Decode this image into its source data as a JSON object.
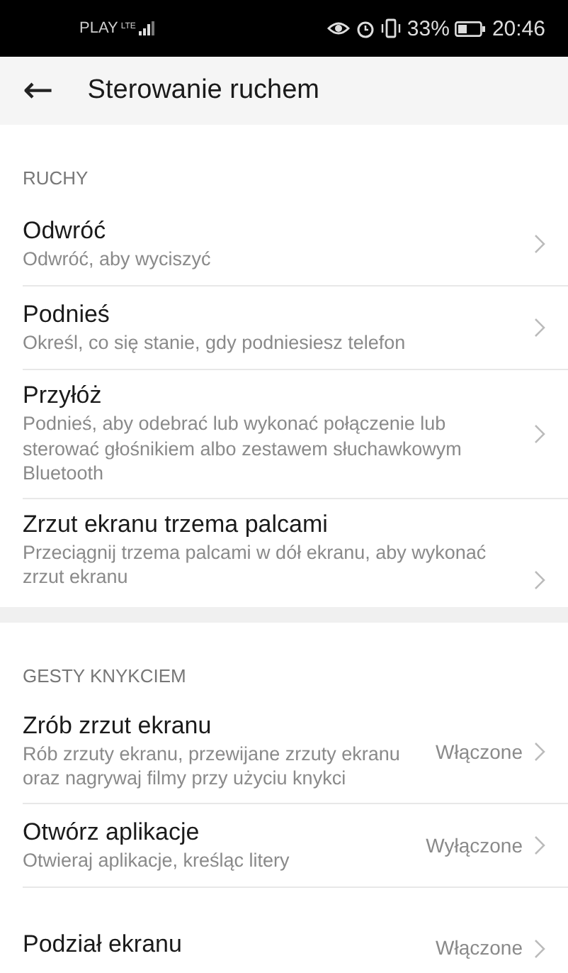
{
  "status_bar": {
    "carrier": "PLAY",
    "network": "LTE",
    "battery_percent": "33%",
    "time": "20:46"
  },
  "header": {
    "back": "←",
    "title": "Sterowanie ruchem"
  },
  "sections": [
    {
      "title": "RUCHY",
      "items": [
        {
          "title": "Odwróć",
          "subtitle": "Odwróć, aby wyciszyć"
        },
        {
          "title": "Podnieś",
          "subtitle": "Określ, co się stanie, gdy podniesiesz telefon"
        },
        {
          "title": "Przyłóż",
          "subtitle": "Podnieś, aby odebrać lub wykonać połączenie lub sterować głośnikiem albo zestawem słuchawkowym Bluetooth"
        },
        {
          "title": "Zrzut ekranu trzema palcami",
          "subtitle": "Przeciągnij trzema palcami w dół ekranu, aby wykonać zrzut ekranu"
        }
      ]
    },
    {
      "title": "GESTY KNYKCIEM",
      "items": [
        {
          "title": "Zrób zrzut ekranu",
          "subtitle": "Rób zrzuty ekranu, przewijane zrzuty ekranu oraz nagrywaj filmy przy użyciu knykci",
          "value": "Włączone"
        },
        {
          "title": "Otwórz aplikacje",
          "subtitle": "Otwieraj aplikacje, kreśląc litery",
          "value": "Wyłączone"
        },
        {
          "title": "Podział ekranu",
          "value": "Włączone"
        }
      ]
    }
  ]
}
